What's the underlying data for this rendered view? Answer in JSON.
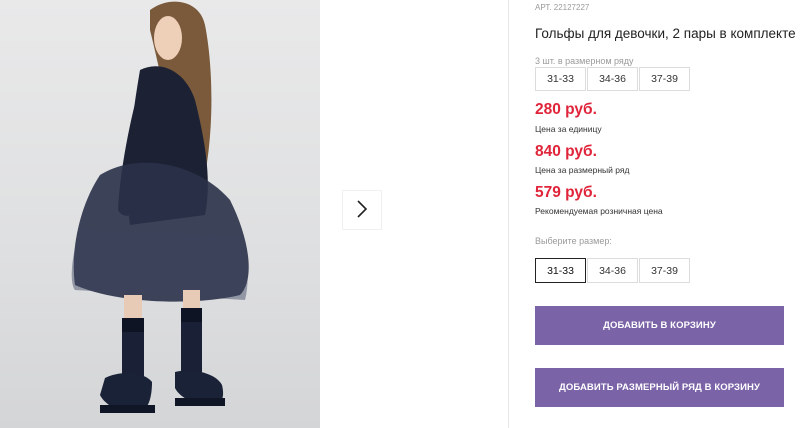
{
  "product": {
    "article": "АРТ. 22127227",
    "title": "Гольфы для девочки, 2 пары в комплекте"
  },
  "set": {
    "label": "3 шт. в размерном ряду",
    "sizes": [
      "31-33",
      "34-36",
      "37-39"
    ]
  },
  "prices": [
    {
      "value": "280 руб.",
      "note": "Цена за единицу"
    },
    {
      "value": "840 руб.",
      "note": "Цена за размерный ряд"
    },
    {
      "value": "579 руб.",
      "note": "Рекомендуемая розничная цена"
    }
  ],
  "choose": {
    "label": "Выберите размер:",
    "sizes": [
      "31-33",
      "34-36",
      "37-39"
    ],
    "selected_index": 0
  },
  "buttons": {
    "add_to_cart": "ДОБАВИТЬ В КОРЗИНУ",
    "add_set_to_cart": "ДОБАВИТЬ РАЗМЕРНЫЙ РЯД В КОРЗИНУ"
  },
  "gallery": {
    "next_icon": "chevron-right-icon"
  },
  "colors": {
    "accent": "#7b63a8",
    "price": "#e0243a"
  }
}
